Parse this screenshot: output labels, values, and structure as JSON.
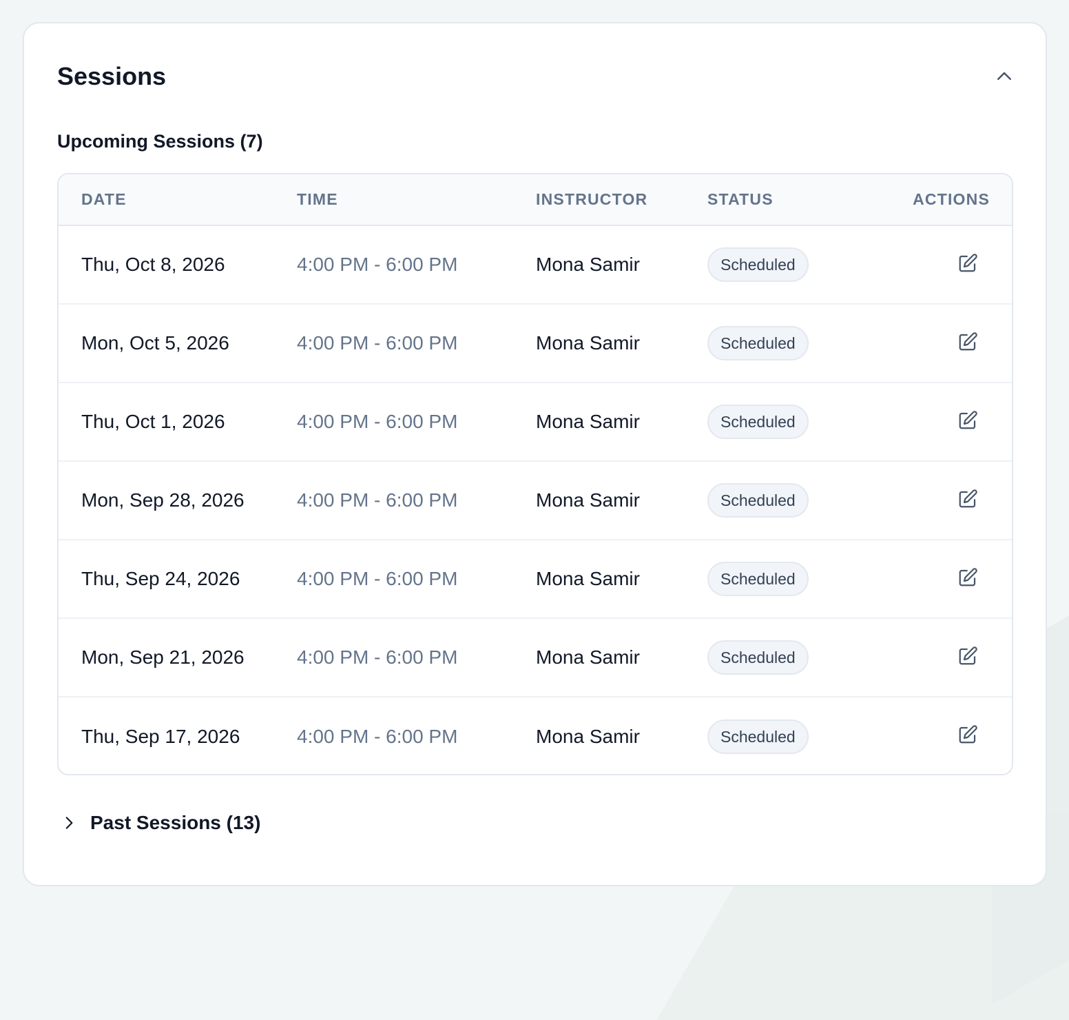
{
  "card": {
    "title": "Sessions",
    "collapse_icon": "chevron-up-icon"
  },
  "upcoming": {
    "heading": "Upcoming Sessions (7)",
    "columns": [
      "Date",
      "Time",
      "Instructor",
      "Status",
      "Actions"
    ],
    "rows": [
      {
        "date": "Thu, Oct 8, 2026",
        "time": "4:00 PM - 6:00 PM",
        "instructor": "Mona Samir",
        "status": "Scheduled"
      },
      {
        "date": "Mon, Oct 5, 2026",
        "time": "4:00 PM - 6:00 PM",
        "instructor": "Mona Samir",
        "status": "Scheduled"
      },
      {
        "date": "Thu, Oct 1, 2026",
        "time": "4:00 PM - 6:00 PM",
        "instructor": "Mona Samir",
        "status": "Scheduled"
      },
      {
        "date": "Mon, Sep 28, 2026",
        "time": "4:00 PM - 6:00 PM",
        "instructor": "Mona Samir",
        "status": "Scheduled"
      },
      {
        "date": "Thu, Sep 24, 2026",
        "time": "4:00 PM - 6:00 PM",
        "instructor": "Mona Samir",
        "status": "Scheduled"
      },
      {
        "date": "Mon, Sep 21, 2026",
        "time": "4:00 PM - 6:00 PM",
        "instructor": "Mona Samir",
        "status": "Scheduled"
      },
      {
        "date": "Thu, Sep 17, 2026",
        "time": "4:00 PM - 6:00 PM",
        "instructor": "Mona Samir",
        "status": "Scheduled"
      }
    ],
    "action_icon": "edit-icon"
  },
  "past": {
    "label": "Past Sessions (13)",
    "expand_icon": "chevron-right-icon"
  },
  "colors": {
    "text": "#111827",
    "muted": "#64748b",
    "border": "#e3e8ef",
    "badge_bg": "#f1f4f8"
  }
}
